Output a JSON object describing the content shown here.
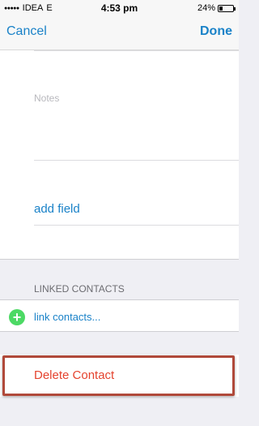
{
  "status_bar": {
    "carrier": "IDEA",
    "network": "E",
    "time": "4:53 pm",
    "battery": "24%"
  },
  "nav": {
    "cancel_label": "Cancel",
    "done_label": "Done"
  },
  "form": {
    "notes_placeholder": "Notes",
    "add_field_label": "add field"
  },
  "linked_contacts": {
    "header": "LINKED CONTACTS",
    "link_label": "link contacts..."
  },
  "delete_label": "Delete Contact",
  "colors": {
    "accent": "#1a82c8",
    "destructive": "#e5432e",
    "add_icon": "#4cd964",
    "highlight_border": "#b0493a"
  },
  "icons": [
    "signal-icon",
    "battery-icon",
    "add-circle-icon"
  ]
}
